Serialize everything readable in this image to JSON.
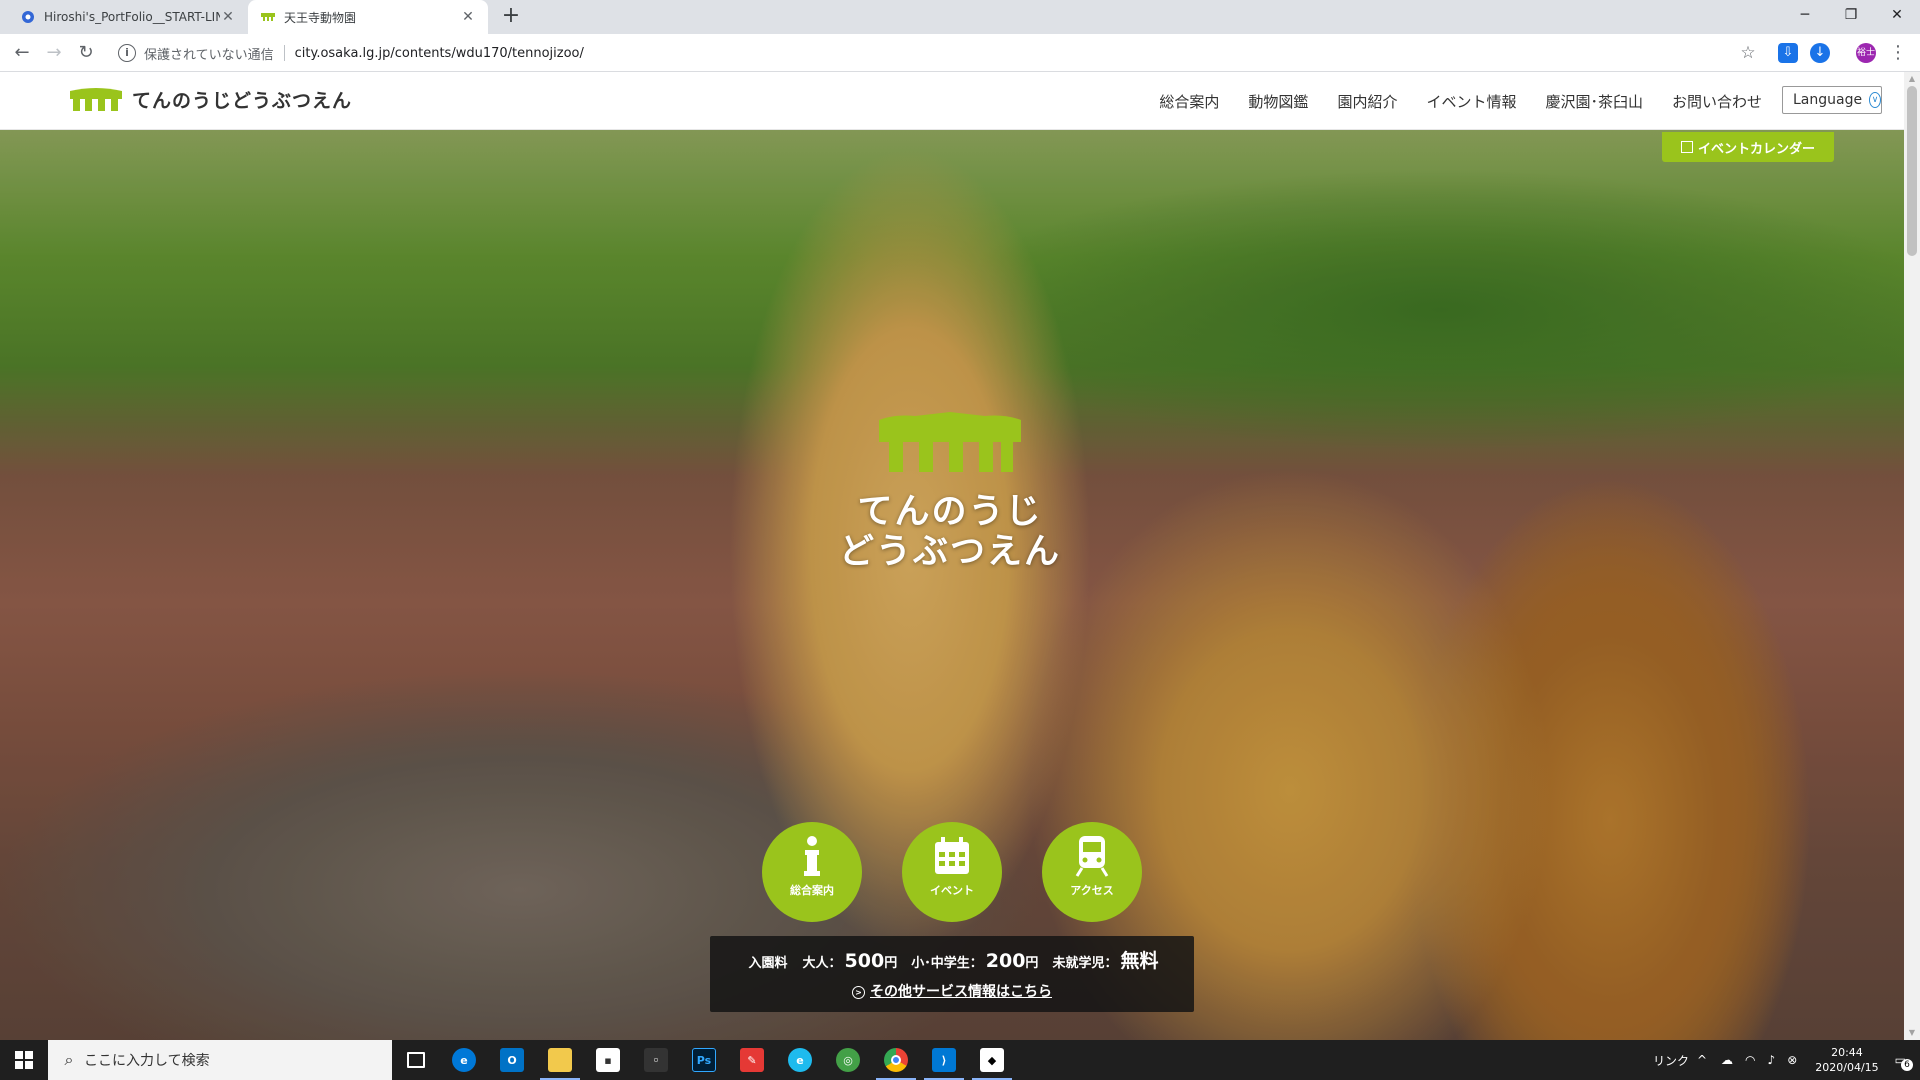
{
  "browser": {
    "tabs": [
      {
        "title": "Hiroshi's_PortFolio__START-LINE",
        "active": false
      },
      {
        "title": "天王寺動物園",
        "active": true
      }
    ],
    "security_label": "保護されていない通信",
    "url": "city.osaka.lg.jp/contents/wdu170/tennojizoo/",
    "profile_initials": "裕士"
  },
  "site": {
    "logo_text": "てんのうじどうぶつえん",
    "nav": [
      "総合案内",
      "動物図鑑",
      "園内紹介",
      "イベント情報",
      "慶沢園･茶臼山",
      "お問い合わせ"
    ],
    "language_label": "Language",
    "event_calendar_label": "イベントカレンダー",
    "hero_title_line1": "てんのうじ",
    "hero_title_line2": "どうぶつえん",
    "quick_links": [
      "総合案内",
      "イベント",
      "アクセス"
    ],
    "fees": {
      "label": "入園料",
      "adult_label": "大人：",
      "adult_price": "500",
      "child_label": "小･中学生：",
      "child_price": "200",
      "infant_label": "未就学児：",
      "infant_price": "無料",
      "yen": "円"
    },
    "more_info_link": "その他サービス情報はこちら"
  },
  "taskbar": {
    "search_placeholder": "ここに入力して検索",
    "tray_text": "リンク",
    "time": "20:44",
    "date": "2020/04/15",
    "notification_count": "6"
  },
  "colors": {
    "brand_green": "#9ac41c",
    "chrome_tabstrip": "#dee1e6",
    "taskbar": "#1f1f1f"
  }
}
